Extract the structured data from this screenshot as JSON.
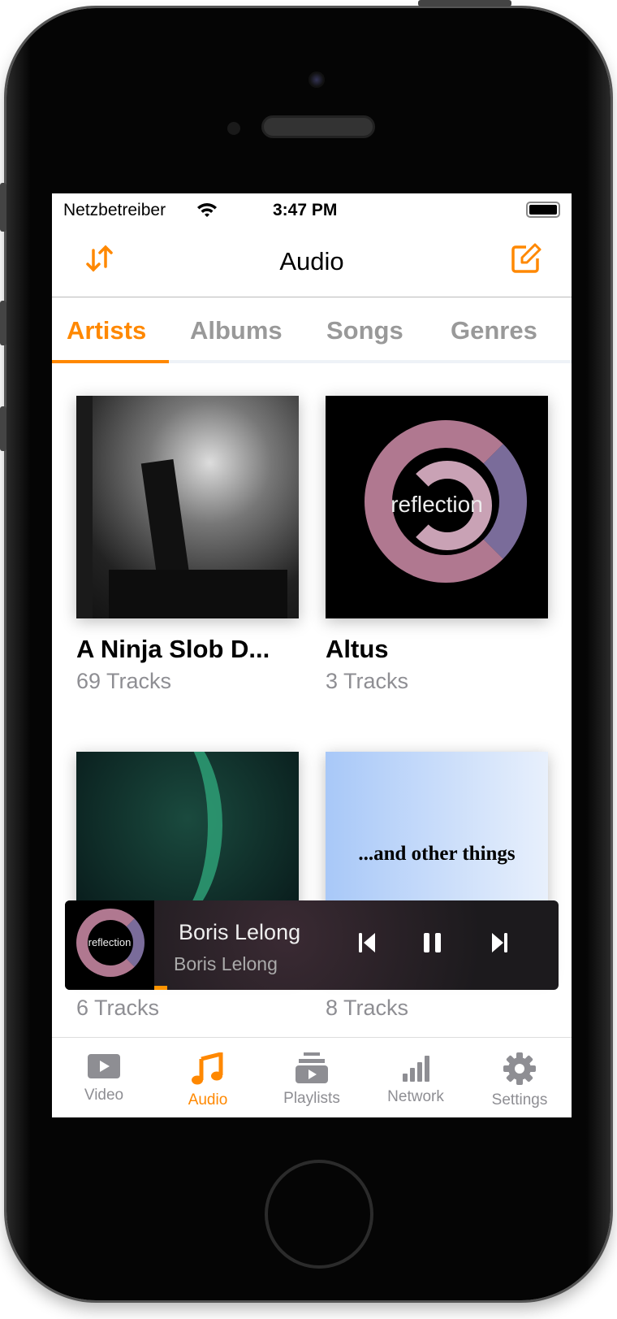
{
  "status_bar": {
    "carrier": "Netzbetreiber",
    "time": "3:47 PM"
  },
  "nav": {
    "title": "Audio",
    "sort_icon": "sort-arrows-icon",
    "edit_icon": "edit-icon"
  },
  "tabs": [
    {
      "label": "Artists",
      "active": true
    },
    {
      "label": "Albums"
    },
    {
      "label": "Songs"
    },
    {
      "label": "Genres"
    }
  ],
  "artists": [
    {
      "name": "A Ninja Slob D...",
      "count": "69 Tracks"
    },
    {
      "name": "Altus",
      "count": "3 Tracks",
      "art_text": "reflection"
    },
    {
      "name": "",
      "count": "6 Tracks"
    },
    {
      "name": "",
      "count": "8 Tracks",
      "art_text": "...and other things"
    }
  ],
  "mini_player": {
    "title": "Boris Lelong",
    "artist": "Boris Lelong",
    "thumb_text": "reflection",
    "progress_percent": 3
  },
  "tabbar": [
    {
      "label": "Video"
    },
    {
      "label": "Audio",
      "active": true
    },
    {
      "label": "Playlists"
    },
    {
      "label": "Network"
    },
    {
      "label": "Settings"
    }
  ],
  "colors": {
    "accent": "#ff8800",
    "inactive": "#8e8e93"
  }
}
